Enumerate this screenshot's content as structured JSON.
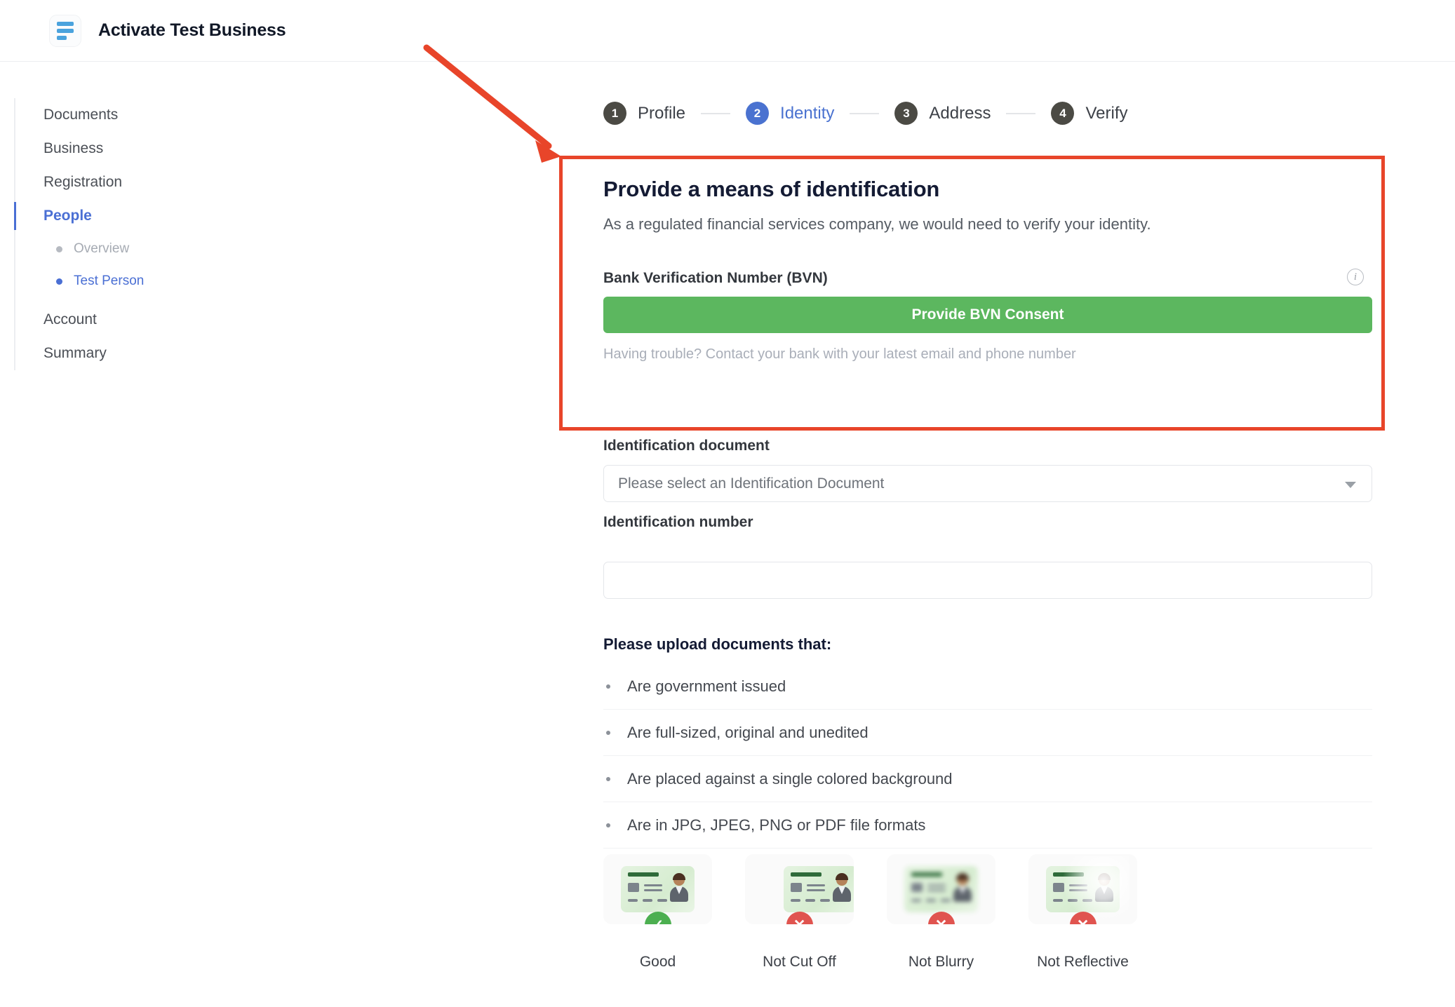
{
  "header": {
    "title": "Activate Test Business",
    "logo_icon": "document-lines-icon"
  },
  "sidebar": {
    "items": [
      {
        "label": "Documents",
        "active": false
      },
      {
        "label": "Business",
        "active": false
      },
      {
        "label": "Registration",
        "active": false
      },
      {
        "label": "People",
        "active": true
      },
      {
        "label": "Account",
        "active": false
      },
      {
        "label": "Summary",
        "active": false
      }
    ],
    "sub_items": [
      {
        "label": "Overview",
        "current": false
      },
      {
        "label": "Test Person",
        "current": true
      }
    ]
  },
  "stepper": {
    "steps": [
      {
        "number": "1",
        "label": "Profile",
        "active": false
      },
      {
        "number": "2",
        "label": "Identity",
        "active": true
      },
      {
        "number": "3",
        "label": "Address",
        "active": false
      },
      {
        "number": "4",
        "label": "Verify",
        "active": false
      }
    ]
  },
  "identity_section": {
    "title": "Provide a means of identification",
    "subtitle": "As a regulated financial services company, we would need to verify your identity.",
    "bvn_label": "Bank Verification Number (BVN)",
    "info_icon": "info-circle-icon",
    "bvn_button": "Provide BVN Consent",
    "bvn_help": "Having trouble? Contact your bank with your latest email and phone number"
  },
  "form": {
    "document_label": "Identification document",
    "document_value": "Please select an Identification Document",
    "document_caret_icon": "chevron-down-icon",
    "number_label": "Identification number",
    "number_value": "",
    "number_placeholder": ""
  },
  "upload_guidelines": {
    "title": "Please upload documents that:",
    "items": [
      "Are government issued",
      "Are full-sized, original and unedited",
      "Are placed against a single colored background",
      "Are in JPG, JPEG, PNG or PDF file formats"
    ]
  },
  "examples": [
    {
      "caption": "Good",
      "status": "ok",
      "badge_icon": "check-icon"
    },
    {
      "caption": "Not Cut Off",
      "status": "bad",
      "badge_icon": "close-icon"
    },
    {
      "caption": "Not Blurry",
      "status": "bad",
      "badge_icon": "close-icon"
    },
    {
      "caption": "Not Reflective",
      "status": "bad",
      "badge_icon": "close-icon"
    }
  ],
  "annotation": {
    "highlight_color": "#e8452a",
    "arrow_icon": "arrow-pointer-icon"
  },
  "colors": {
    "accent_blue": "#4a72d0",
    "consent_green": "#5cb75f",
    "annotation_red": "#e8452a",
    "logo_blue": "#4ba3dd"
  }
}
